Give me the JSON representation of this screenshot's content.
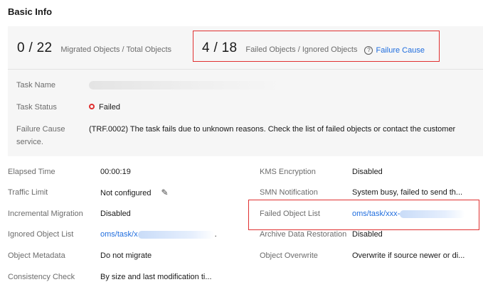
{
  "section_title": "Basic Info",
  "stats": {
    "migrated": {
      "value": "0 / 22",
      "label": "Migrated Objects / Total Objects"
    },
    "failed": {
      "value": "4 / 18",
      "label": "Failed Objects / Ignored Objects",
      "help_link": "Failure Cause"
    }
  },
  "task": {
    "name_label": "Task Name",
    "status_label": "Task Status",
    "status_value": "Failed",
    "failure_label_line1": "Failure Cause",
    "failure_label_line2": "service.",
    "failure_text_line1": "(TRF.0002) The task fails due to unknown reasons. Check the list of failed objects or contact the customer"
  },
  "left_details": [
    {
      "label": "Elapsed Time",
      "value": "00:00:19"
    },
    {
      "label": "Traffic Limit",
      "value": "Not configured"
    },
    {
      "label": "Incremental Migration",
      "value": "Disabled"
    },
    {
      "label": "Ignored Object List",
      "value": "oms/task/x",
      "suffix": "."
    },
    {
      "label": "Object Metadata",
      "value": "Do not migrate"
    },
    {
      "label": "Consistency Check",
      "value": "By size and last modification ti..."
    }
  ],
  "right_details": [
    {
      "label": "KMS Encryption",
      "value": "Disabled"
    },
    {
      "label": "SMN Notification",
      "value": "System busy, failed to send th..."
    },
    {
      "label": "Failed Object List",
      "value": "oms/task/xxx-"
    },
    {
      "label": "Archive Data Restoration",
      "value": "Disabled"
    },
    {
      "label": "Object Overwrite",
      "value": "Overwrite if source newer or di..."
    }
  ],
  "colors": {
    "accent_link": "#1f6dde",
    "highlight_border": "#e03030",
    "status_failed": "#e03030",
    "panel_bg": "#f6f6f6"
  },
  "icons": {
    "help": "question-circle-icon",
    "status": "status-ring-icon",
    "edit": "edit-pencil-icon"
  }
}
